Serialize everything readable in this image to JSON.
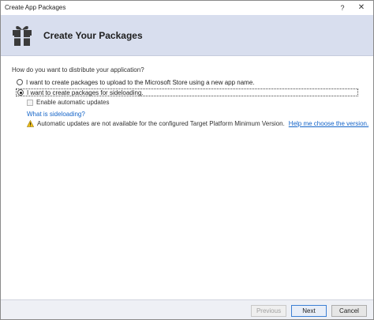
{
  "window": {
    "title": "Create App Packages",
    "help_glyph": "?",
    "close_glyph": "✕"
  },
  "header": {
    "title": "Create Your Packages",
    "icon": "package-gift-icon"
  },
  "distribution": {
    "question": "How do you want to distribute your application?",
    "options": [
      {
        "label": "I want to create packages to upload to the Microsoft Store using a new app name.",
        "selected": false
      },
      {
        "label": "I want to create packages for sideloading.",
        "selected": true
      }
    ],
    "auto_updates": {
      "label": "Enable automatic updates",
      "checked": false,
      "enabled": false
    },
    "sideloading_link": "What is sideloading?",
    "warning": {
      "icon": "warning-icon",
      "text": "Automatic updates are not available for the configured Target Platform Minimum Version.",
      "link": "Help me choose the version."
    }
  },
  "footer": {
    "previous": "Previous",
    "next": "Next",
    "cancel": "Cancel"
  },
  "colors": {
    "header_bg": "#d8deee",
    "link": "#1464c8",
    "warning": "#f2c01a",
    "footer_bg": "#eef0f5"
  }
}
